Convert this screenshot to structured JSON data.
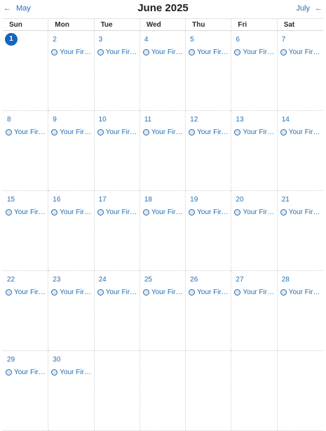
{
  "header": {
    "title": "June 2025",
    "prev_label": "May",
    "next_label": "July",
    "prev_icon": "arrow-left-icon",
    "next_icon": "arrow-left-icon"
  },
  "weekdays": [
    "Sun",
    "Mon",
    "Tue",
    "Wed",
    "Thu",
    "Fri",
    "Sat"
  ],
  "today": "1",
  "event_label": "Your Firs...",
  "weeks": [
    [
      {
        "day": "1",
        "event": false
      },
      {
        "day": "2",
        "event": true
      },
      {
        "day": "3",
        "event": true
      },
      {
        "day": "4",
        "event": true
      },
      {
        "day": "5",
        "event": true
      },
      {
        "day": "6",
        "event": true
      },
      {
        "day": "7",
        "event": true
      }
    ],
    [
      {
        "day": "8",
        "event": true
      },
      {
        "day": "9",
        "event": true
      },
      {
        "day": "10",
        "event": true
      },
      {
        "day": "11",
        "event": true
      },
      {
        "day": "12",
        "event": true
      },
      {
        "day": "13",
        "event": true
      },
      {
        "day": "14",
        "event": true
      }
    ],
    [
      {
        "day": "15",
        "event": true
      },
      {
        "day": "16",
        "event": true
      },
      {
        "day": "17",
        "event": true
      },
      {
        "day": "18",
        "event": true
      },
      {
        "day": "19",
        "event": true
      },
      {
        "day": "20",
        "event": true
      },
      {
        "day": "21",
        "event": true
      }
    ],
    [
      {
        "day": "22",
        "event": true
      },
      {
        "day": "23",
        "event": true
      },
      {
        "day": "24",
        "event": true
      },
      {
        "day": "25",
        "event": true
      },
      {
        "day": "26",
        "event": true
      },
      {
        "day": "27",
        "event": true
      },
      {
        "day": "28",
        "event": true
      }
    ],
    [
      {
        "day": "29",
        "event": true
      },
      {
        "day": "30",
        "event": true
      },
      {
        "day": "",
        "event": false
      },
      {
        "day": "",
        "event": false
      },
      {
        "day": "",
        "event": false
      },
      {
        "day": "",
        "event": false
      },
      {
        "day": "",
        "event": false
      }
    ]
  ]
}
